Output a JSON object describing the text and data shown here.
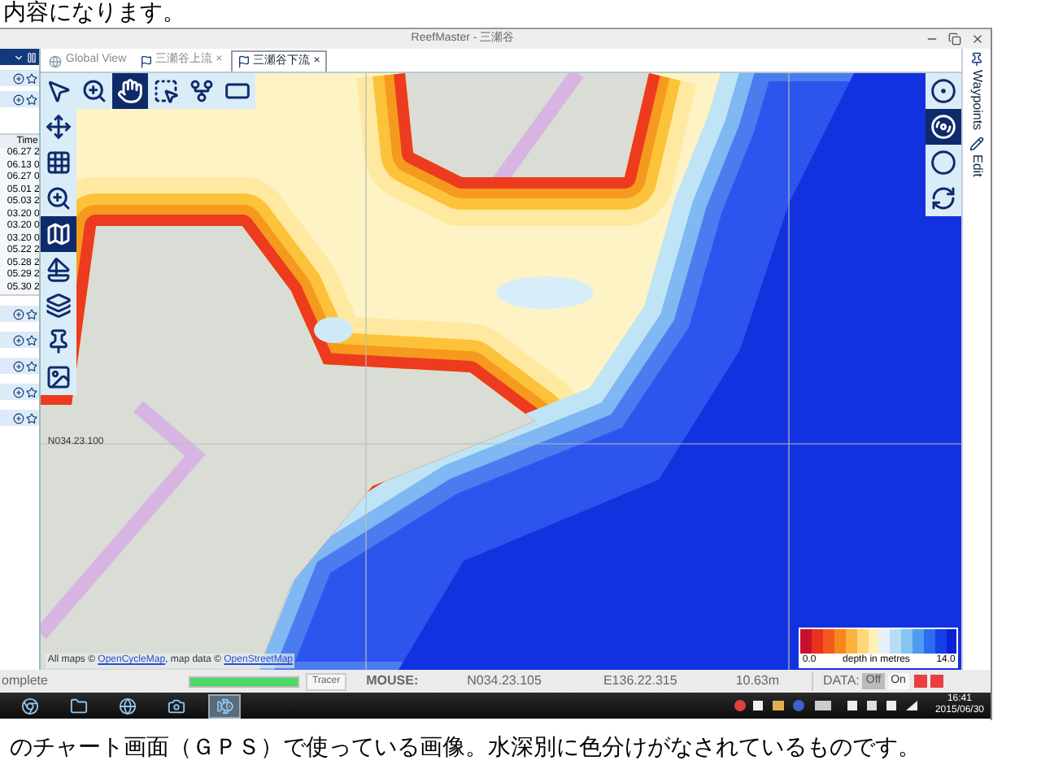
{
  "captions": {
    "top": "内容になります。",
    "bottom": "のチャート画面（ＧＰＳ）で使っている画像。水深別に色分けがなされているものです。"
  },
  "window": {
    "title": "ReefMaster - 三瀬谷"
  },
  "tabs": [
    {
      "label": "Global View",
      "kind": "globe",
      "selected": false
    },
    {
      "label": "三瀬谷上流",
      "kind": "chart",
      "selected": false,
      "close": "×"
    },
    {
      "label": "三瀬谷下流",
      "kind": "chart",
      "selected": true,
      "close": "×"
    }
  ],
  "side_panel": {
    "time_header": "Time",
    "times": [
      "06.27 2",
      "06.13 0",
      "06.27 0",
      "05.01 2",
      "05.03 2",
      "03.20 0",
      "03.20 0",
      "03.20 0",
      "05.22 2",
      "05.28 2",
      "05.29 2",
      "05.30 2"
    ]
  },
  "top_tools": [
    {
      "kind": "pointer",
      "selected": false
    },
    {
      "kind": "zoom",
      "selected": false
    },
    {
      "kind": "hand",
      "selected": true
    },
    {
      "kind": "select",
      "selected": false
    },
    {
      "kind": "fork",
      "selected": false
    },
    {
      "kind": "label",
      "selected": false
    }
  ],
  "left_tools": [
    {
      "kind": "move",
      "selected": false
    },
    {
      "kind": "grid",
      "selected": false
    },
    {
      "kind": "zoom",
      "selected": false
    },
    {
      "kind": "map",
      "selected": true
    },
    {
      "kind": "boat",
      "selected": false
    },
    {
      "kind": "layers",
      "selected": false
    },
    {
      "kind": "pin",
      "selected": false
    },
    {
      "kind": "image",
      "selected": false
    }
  ],
  "right_tools": [
    {
      "kind": "target",
      "selected": false
    },
    {
      "kind": "contour",
      "selected": true
    },
    {
      "kind": "ring",
      "selected": false
    },
    {
      "kind": "refresh",
      "selected": false
    }
  ],
  "right_tabs": [
    {
      "label": "Waypoints",
      "kind": "pin"
    },
    {
      "label": "Edit",
      "kind": "pencil"
    }
  ],
  "map": {
    "grid_label": "N034.23.100",
    "attribution": [
      {
        "text": "All maps © ",
        "link": false
      },
      {
        "text": "OpenCycleMap",
        "link": true
      },
      {
        "text": ", map data © ",
        "link": false
      },
      {
        "text": "OpenStreetMap",
        "link": true
      }
    ],
    "legend": {
      "min": "0.0",
      "title": "depth in metres",
      "max": "14.0"
    }
  },
  "status_bar": {
    "task": "omplete",
    "progress": {
      "level": 1
    },
    "tracer": "Tracer",
    "mouse_label": "MOUSE:",
    "lat": "N034.23.105",
    "lon": "E136.22.315",
    "depth": "10.63m",
    "data_label": "DATA:",
    "toggle": [
      {
        "label": "Off",
        "selected": true
      },
      {
        "label": "On",
        "selected": false
      }
    ]
  },
  "taskbar": {
    "apps": [
      {
        "kind": "chrome",
        "selected": false
      },
      {
        "kind": "folder",
        "selected": false
      },
      {
        "kind": "globe",
        "selected": false
      },
      {
        "kind": "camera",
        "selected": false
      },
      {
        "kind": "fish",
        "selected": true
      }
    ],
    "time": "16:41",
    "date": "2015/06/30"
  }
}
